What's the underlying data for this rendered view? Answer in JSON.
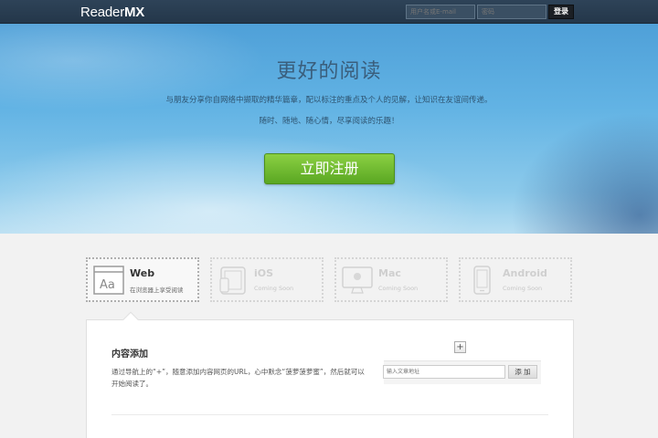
{
  "header": {
    "logo_text": "Reader",
    "logo_bold": "MX",
    "username_placeholder": "用户名或E-mail",
    "password_placeholder": "密码",
    "login_label": "登录"
  },
  "hero": {
    "title": "更好的阅读",
    "subtitle1": "与朋友分享你自网络中撷取的精华篇章，配以标注的重点及个人的见解，让知识在友谊间传递。",
    "subtitle2": "随时、随地、随心情，尽享阅读的乐趣！",
    "signup_label": "立即注册"
  },
  "platforms": [
    {
      "name": "Web",
      "desc": "在浏览器上享受阅读",
      "icon": "browser-icon",
      "active": true
    },
    {
      "name": "iOS",
      "desc": "Coming Soon",
      "icon": "ipad-icon",
      "active": false
    },
    {
      "name": "Mac",
      "desc": "Coming Soon",
      "icon": "imac-icon",
      "active": false
    },
    {
      "name": "Android",
      "desc": "Coming Soon",
      "icon": "phone-icon",
      "active": false
    }
  ],
  "feature": {
    "title": "内容添加",
    "desc": "通过导航上的“+”，随意添加内容网页的URL，心中默念“菠萝菠萝蜜”，然后就可以开始阅读了。",
    "plus_label": "+",
    "url_placeholder": "输入文章地址",
    "add_label": "添 加"
  }
}
